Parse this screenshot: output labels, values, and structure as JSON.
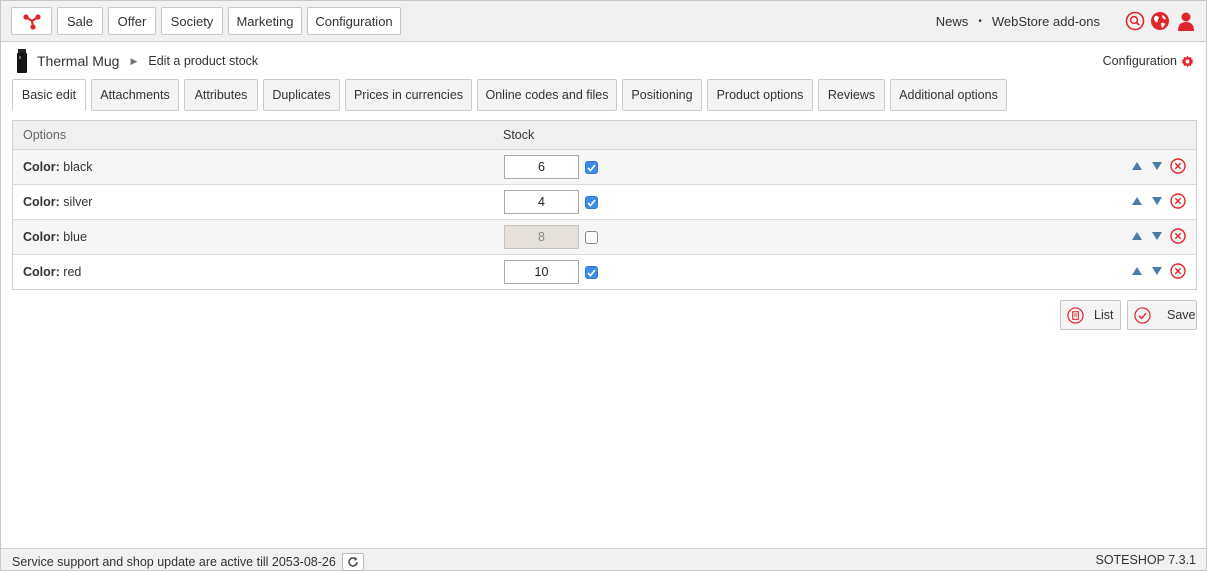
{
  "topbar": {
    "logo_icon": "soteshop-logo-icon",
    "menu": [
      {
        "label": "Sale"
      },
      {
        "label": "Offer"
      },
      {
        "label": "Society"
      },
      {
        "label": "Marketing"
      },
      {
        "label": "Configuration"
      }
    ],
    "links": {
      "news": "News",
      "separator": "•",
      "addons": "WebStore add-ons"
    },
    "icons": [
      "search-icon",
      "globe-icon",
      "user-icon"
    ],
    "accent": "#e0262b"
  },
  "breadcrumb": {
    "product": "Thermal Mug",
    "page": "Edit a product stock"
  },
  "config_link": "Configuration",
  "tabs": [
    {
      "label": "Basic edit",
      "active": true
    },
    {
      "label": "Attachments"
    },
    {
      "label": "Attributes"
    },
    {
      "label": "Duplicates"
    },
    {
      "label": "Prices in currencies"
    },
    {
      "label": "Online codes and files"
    },
    {
      "label": "Positioning"
    },
    {
      "label": "Product options"
    },
    {
      "label": "Reviews"
    },
    {
      "label": "Additional options"
    }
  ],
  "table": {
    "headers": {
      "options": "Options",
      "stock": "Stock"
    },
    "rows": [
      {
        "key": "Color:",
        "value": "black",
        "stock": "6",
        "checked": true
      },
      {
        "key": "Color:",
        "value": "silver",
        "stock": "4",
        "checked": true
      },
      {
        "key": "Color:",
        "value": "blue",
        "stock": "8",
        "checked": false
      },
      {
        "key": "Color:",
        "value": "red",
        "stock": "10",
        "checked": true
      }
    ]
  },
  "buttons": {
    "list": "List",
    "save": "Save"
  },
  "footer": {
    "support": "Service support and shop update are active till 2053-08-26",
    "version": "SOTESHOP 7.3.1"
  }
}
